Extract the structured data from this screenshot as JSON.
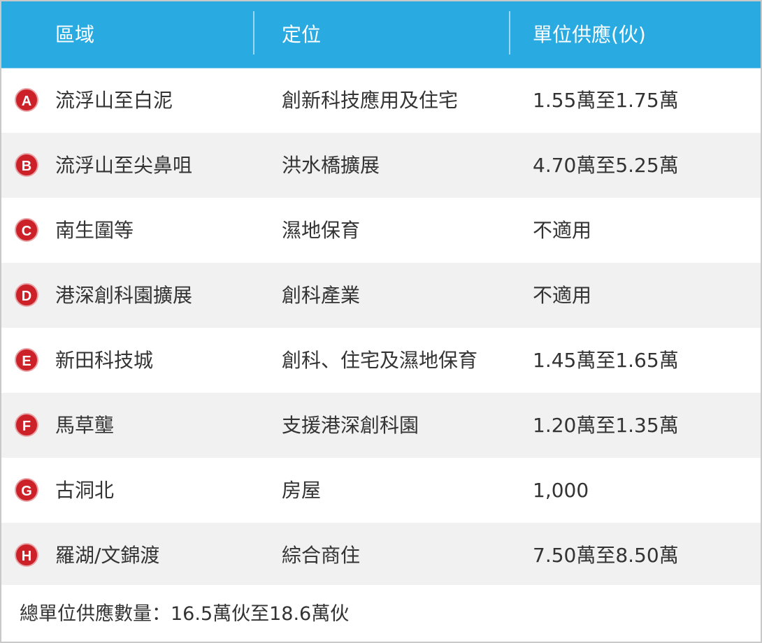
{
  "colors": {
    "header_bg": "#29abe2",
    "header_text": "#ffffff",
    "badge_bg": "#cc2129",
    "row_alt_bg": "#f1f1f1",
    "text": "#333333"
  },
  "table": {
    "headers": [
      "區域",
      "定位",
      "單位供應(伙)"
    ],
    "rows": [
      {
        "badge": "A",
        "area": "流浮山至白泥",
        "positioning": "創新科技應用及住宅",
        "supply": "1.55萬至1.75萬"
      },
      {
        "badge": "B",
        "area": "流浮山至尖鼻咀",
        "positioning": "洪水橋擴展",
        "supply": "4.70萬至5.25萬"
      },
      {
        "badge": "C",
        "area": "南生圍等",
        "positioning": "濕地保育",
        "supply": "不適用"
      },
      {
        "badge": "D",
        "area": "港深創科園擴展",
        "positioning": "創科產業",
        "supply": "不適用"
      },
      {
        "badge": "E",
        "area": "新田科技城",
        "positioning": "創科、住宅及濕地保育",
        "supply": "1.45萬至1.65萬"
      },
      {
        "badge": "F",
        "area": "馬草壟",
        "positioning": "支援港深創科園",
        "supply": "1.20萬至1.35萬"
      },
      {
        "badge": "G",
        "area": "古洞北",
        "positioning": "房屋",
        "supply": "1,000"
      },
      {
        "badge": "H",
        "area": "羅湖/文錦渡",
        "positioning": "綜合商住",
        "supply": "7.50萬至8.50萬"
      }
    ]
  },
  "footer": {
    "total": "總單位供應數量：16.5萬伙至18.6萬伙"
  }
}
